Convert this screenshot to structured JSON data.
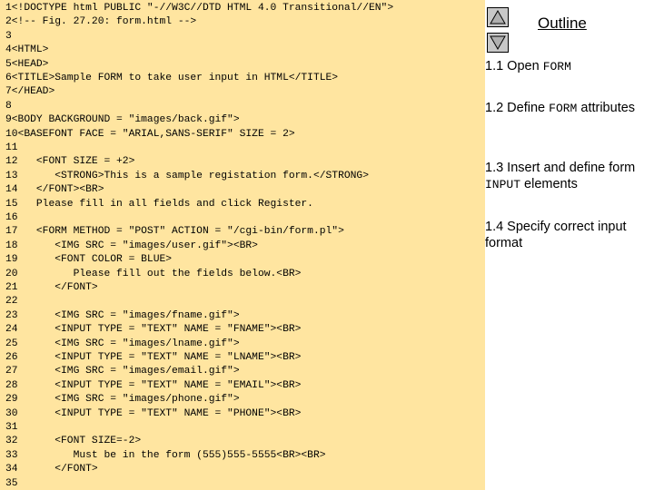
{
  "code": {
    "lines": [
      {
        "num": "1",
        "text": "<!DOCTYPE html PUBLIC \"-//W3C//DTD HTML 4.0 Transitional//EN\">"
      },
      {
        "num": "2",
        "text": "<!-- Fig. 27.20: form.html -->"
      },
      {
        "num": "3",
        "text": ""
      },
      {
        "num": "4",
        "text": "<HTML>"
      },
      {
        "num": "5",
        "text": "<HEAD>"
      },
      {
        "num": "6",
        "text": "<TITLE>Sample FORM to take user input in HTML</TITLE>"
      },
      {
        "num": "7",
        "text": "</HEAD>"
      },
      {
        "num": "8",
        "text": ""
      },
      {
        "num": "9",
        "text": "<BODY BACKGROUND = \"images/back.gif\">"
      },
      {
        "num": "10",
        "text": "<BASEFONT FACE = \"ARIAL,SANS-SERIF\" SIZE = 2>"
      },
      {
        "num": "11",
        "text": ""
      },
      {
        "num": "12",
        "text": "   <FONT SIZE = +2>"
      },
      {
        "num": "13",
        "text": "      <STRONG>This is a sample registation form.</STRONG>"
      },
      {
        "num": "14",
        "text": "   </FONT><BR>"
      },
      {
        "num": "15",
        "text": "   Please fill in all fields and click Register."
      },
      {
        "num": "16",
        "text": ""
      },
      {
        "num": "17",
        "text": "   <FORM METHOD = \"POST\" ACTION = \"/cgi-bin/form.pl\">"
      },
      {
        "num": "18",
        "text": "      <IMG SRC = \"images/user.gif\"><BR>"
      },
      {
        "num": "19",
        "text": "      <FONT COLOR = BLUE>"
      },
      {
        "num": "20",
        "text": "         Please fill out the fields below.<BR>"
      },
      {
        "num": "21",
        "text": "      </FONT>"
      },
      {
        "num": "22",
        "text": ""
      },
      {
        "num": "23",
        "text": "      <IMG SRC = \"images/fname.gif\">"
      },
      {
        "num": "24",
        "text": "      <INPUT TYPE = \"TEXT\" NAME = \"FNAME\"><BR>"
      },
      {
        "num": "25",
        "text": "      <IMG SRC = \"images/lname.gif\">"
      },
      {
        "num": "26",
        "text": "      <INPUT TYPE = \"TEXT\" NAME = \"LNAME\"><BR>"
      },
      {
        "num": "27",
        "text": "      <IMG SRC = \"images/email.gif\">"
      },
      {
        "num": "28",
        "text": "      <INPUT TYPE = \"TEXT\" NAME = \"EMAIL\"><BR>"
      },
      {
        "num": "29",
        "text": "      <IMG SRC = \"images/phone.gif\">"
      },
      {
        "num": "30",
        "text": "      <INPUT TYPE = \"TEXT\" NAME = \"PHONE\"><BR>"
      },
      {
        "num": "31",
        "text": ""
      },
      {
        "num": "32",
        "text": "      <FONT SIZE=-2>"
      },
      {
        "num": "33",
        "text": "         Must be in the form (555)555-5555<BR><BR>"
      },
      {
        "num": "34",
        "text": "      </FONT>"
      },
      {
        "num": "35",
        "text": ""
      }
    ]
  },
  "outline": {
    "title": "Outline",
    "items": [
      {
        "prefix": "1.1 Open ",
        "code": "FORM",
        "suffix": ""
      },
      {
        "prefix": "1.2 Define ",
        "code": "FORM",
        "suffix": " attributes"
      },
      {
        "prefix": "1.3 Insert and define form ",
        "code": "INPUT",
        "suffix": " elements"
      },
      {
        "prefix": "1.4 Specify correct input format",
        "code": "",
        "suffix": ""
      }
    ]
  },
  "nav": {
    "up_icon": "triangle-up-icon",
    "down_icon": "triangle-down-icon"
  },
  "colors": {
    "code_background": "#ffe5a0",
    "button_gray": "#c8c8c8"
  }
}
